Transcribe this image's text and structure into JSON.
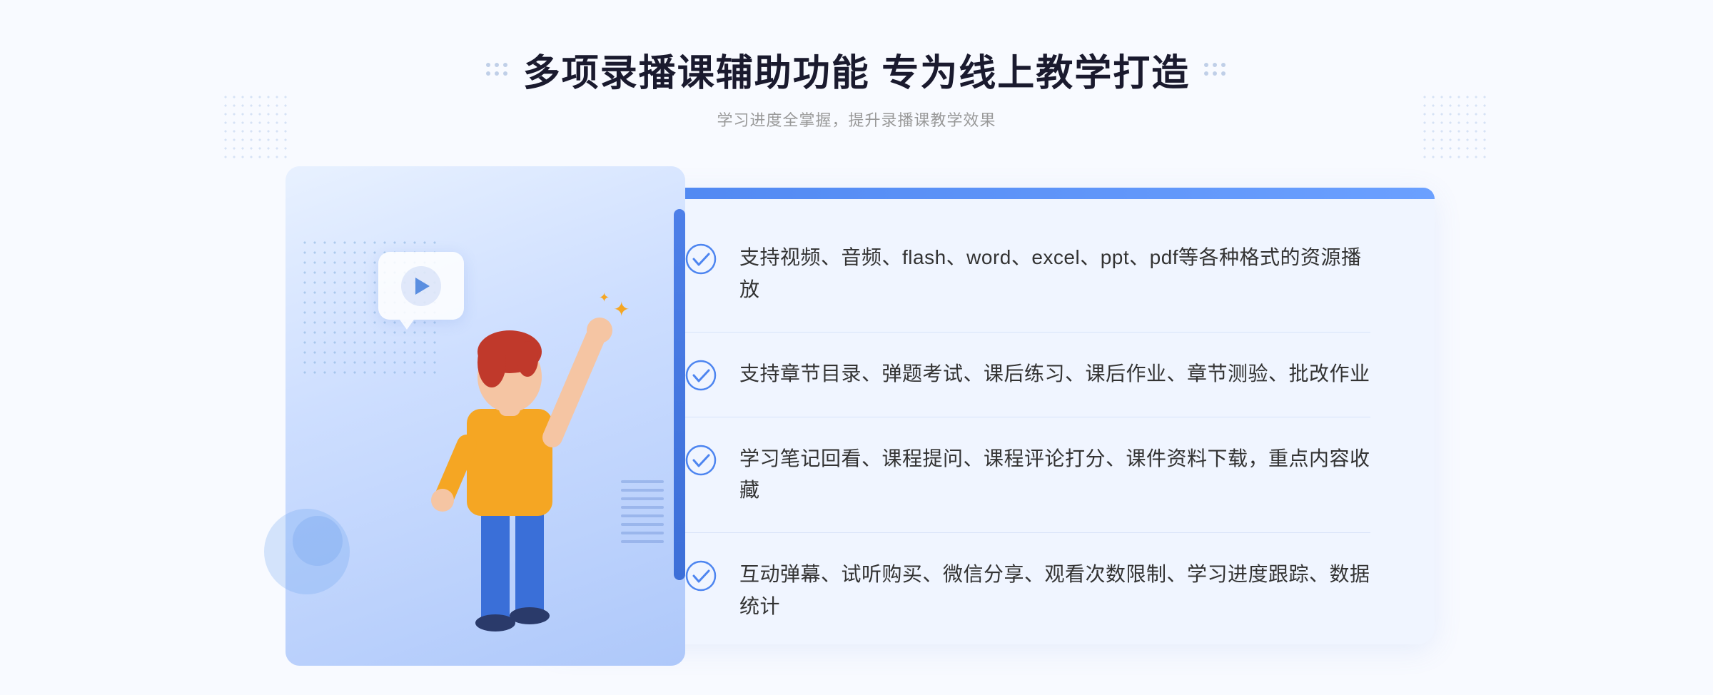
{
  "header": {
    "title": "多项录播课辅助功能 专为线上教学打造",
    "subtitle": "学习进度全掌握，提升录播课教学效果",
    "decorator_left": "decorator-left",
    "decorator_right": "decorator-right"
  },
  "features": [
    {
      "id": "feature-1",
      "text": "支持视频、音频、flash、word、excel、ppt、pdf等各种格式的资源播放",
      "check_icon": "check-circle-icon"
    },
    {
      "id": "feature-2",
      "text": "支持章节目录、弹题考试、课后练习、课后作业、章节测验、批改作业",
      "check_icon": "check-circle-icon"
    },
    {
      "id": "feature-3",
      "text": "学习笔记回看、课程提问、课程评论打分、课件资料下载，重点内容收藏",
      "check_icon": "check-circle-icon"
    },
    {
      "id": "feature-4",
      "text": "互动弹幕、试听购买、微信分享、观看次数限制、学习进度跟踪、数据统计",
      "check_icon": "check-circle-icon"
    }
  ],
  "illustration": {
    "play_button": "play-icon",
    "figure": "student-figure"
  },
  "colors": {
    "accent_blue": "#4d85f0",
    "light_blue": "#6ba0ff",
    "text_dark": "#1a1a2e",
    "text_gray": "#999999",
    "feature_text": "#333333",
    "bg_card": "#f0f5ff",
    "check_color": "#4d85f0"
  }
}
